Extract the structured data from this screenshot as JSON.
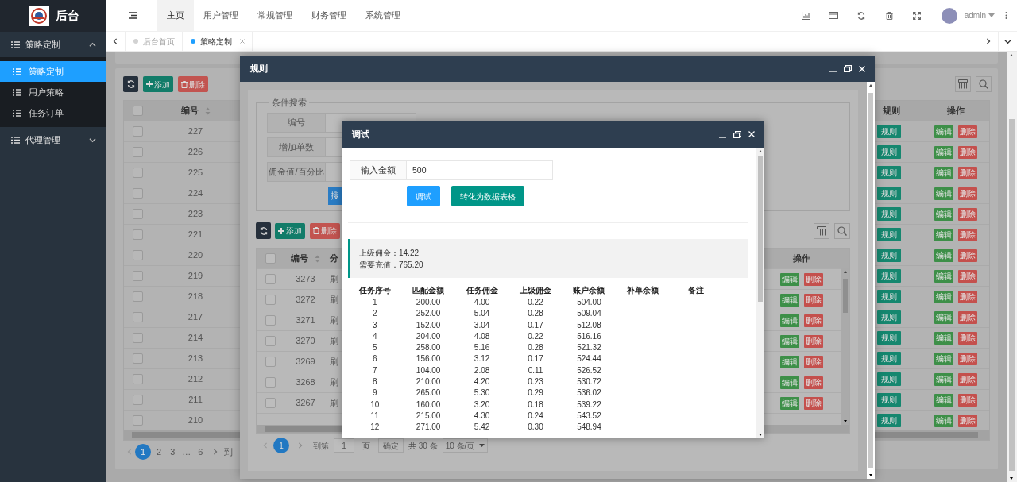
{
  "sidebar": {
    "logo_text": "后台",
    "menu": [
      {
        "label": "策略定制",
        "expanded": true,
        "children": [
          {
            "label": "策略定制",
            "selected": true
          },
          {
            "label": "用户策略",
            "selected": false
          },
          {
            "label": "任务订单",
            "selected": false
          }
        ]
      },
      {
        "label": "代理管理",
        "expanded": false
      }
    ]
  },
  "header": {
    "nav": [
      {
        "label": "主页",
        "selected": true
      },
      {
        "label": "用户管理",
        "selected": false
      },
      {
        "label": "常规管理",
        "selected": false
      },
      {
        "label": "财务管理",
        "selected": false
      },
      {
        "label": "系统管理",
        "selected": false
      }
    ],
    "user": "admin"
  },
  "tabs": [
    {
      "label": "后台首页",
      "selected": false,
      "closable": false
    },
    {
      "label": "策略定制",
      "selected": true,
      "closable": true
    }
  ],
  "page": {
    "toolbar": {
      "add": "添加",
      "delete": "删除"
    },
    "table": {
      "columns": [
        "编号",
        "规则",
        "操作"
      ],
      "all_checked": false,
      "rows": [
        {
          "id": "227",
          "checked": false,
          "rule": "规则",
          "edit": "编辑",
          "delete": "删除"
        },
        {
          "id": "226",
          "checked": false,
          "rule": "规则",
          "edit": "编辑",
          "delete": "删除"
        },
        {
          "id": "225",
          "checked": false,
          "rule": "规则",
          "edit": "编辑",
          "delete": "删除"
        },
        {
          "id": "224",
          "checked": false,
          "rule": "规则",
          "edit": "编辑",
          "delete": "删除"
        },
        {
          "id": "223",
          "checked": false,
          "rule": "规则",
          "edit": "编辑",
          "delete": "删除"
        },
        {
          "id": "221",
          "checked": false,
          "rule": "规则",
          "edit": "编辑",
          "delete": "删除"
        },
        {
          "id": "220",
          "checked": false,
          "rule": "规则",
          "edit": "编辑",
          "delete": "删除"
        },
        {
          "id": "219",
          "checked": false,
          "rule": "规则",
          "edit": "编辑",
          "delete": "删除"
        },
        {
          "id": "218",
          "checked": false,
          "rule": "规则",
          "edit": "编辑",
          "delete": "删除"
        },
        {
          "id": "217",
          "checked": false,
          "rule": "规则",
          "edit": "编辑",
          "delete": "删除"
        },
        {
          "id": "214",
          "checked": false,
          "rule": "规则",
          "edit": "编辑",
          "delete": "删除"
        },
        {
          "id": "213",
          "checked": false,
          "rule": "规则",
          "edit": "编辑",
          "delete": "删除"
        },
        {
          "id": "212",
          "checked": false,
          "rule": "规则",
          "edit": "编辑",
          "delete": "删除"
        },
        {
          "id": "211",
          "checked": false,
          "rule": "规则",
          "edit": "编辑",
          "delete": "删除"
        },
        {
          "id": "210",
          "checked": false,
          "rule": "规则",
          "edit": "编辑",
          "delete": "删除"
        }
      ]
    },
    "pagination": {
      "pages": [
        {
          "label": "1",
          "kind": "page",
          "selected": true
        },
        {
          "label": "2",
          "kind": "page",
          "selected": false
        },
        {
          "label": "3",
          "kind": "page",
          "selected": false
        },
        {
          "label": "…",
          "kind": "ellipsis"
        },
        {
          "label": "6",
          "kind": "page",
          "selected": false
        }
      ],
      "goto_label": "到"
    }
  },
  "rule_dialog": {
    "title": "规则",
    "search": {
      "legend": "条件搜索",
      "fields": [
        "编号",
        "增加单数",
        "佣金值/百分比"
      ],
      "button": "搜"
    },
    "toolbar": {
      "add": "添加",
      "delete": "删除"
    },
    "table": {
      "columns": [
        "编号",
        "分",
        "操作"
      ],
      "all_checked": false,
      "rows": [
        {
          "id": "3273",
          "checked": false,
          "column_2": "刷",
          "edit": "编辑",
          "delete": "删除"
        },
        {
          "id": "3272",
          "checked": false,
          "column_2": "刷",
          "edit": "编辑",
          "delete": "删除"
        },
        {
          "id": "3271",
          "checked": false,
          "column_2": "刷",
          "edit": "编辑",
          "delete": "删除"
        },
        {
          "id": "3270",
          "checked": false,
          "column_2": "刷",
          "edit": "编辑",
          "delete": "删除"
        },
        {
          "id": "3269",
          "checked": false,
          "column_2": "刷",
          "edit": "编辑",
          "delete": "删除"
        },
        {
          "id": "3268",
          "checked": false,
          "column_2": "刷",
          "edit": "编辑",
          "delete": "删除"
        },
        {
          "id": "3267",
          "checked": false,
          "column_2": "刷",
          "edit": "编辑",
          "delete": "删除"
        }
      ]
    },
    "pagination": {
      "pages": [
        {
          "label": "1",
          "selected": true
        }
      ],
      "goto_label": "到第",
      "goto_value": "1",
      "page_label": "页",
      "confirm": "确定",
      "total": "共 30 条",
      "page_size": "10 条/页"
    }
  },
  "debug_dialog": {
    "title": "调试",
    "amount_label": "输入金额",
    "amount_value": "500",
    "buttons": [
      {
        "label": "调试",
        "kind": "primary"
      },
      {
        "label": "转化为数据表格",
        "kind": "teal"
      }
    ],
    "summary": [
      "上级佣金：14.22",
      "需要充值：765.20"
    ],
    "table": {
      "columns": [
        "任务序号",
        "匹配金额",
        "任务佣金",
        "上级佣金",
        "账户余额",
        "补单余额",
        "备注"
      ],
      "rows": [
        [
          "1",
          "200.00",
          "4.00",
          "0.22",
          "504.00"
        ],
        [
          "2",
          "252.00",
          "5.04",
          "0.28",
          "509.04"
        ],
        [
          "3",
          "152.00",
          "3.04",
          "0.17",
          "512.08"
        ],
        [
          "4",
          "204.00",
          "4.08",
          "0.22",
          "516.16"
        ],
        [
          "5",
          "258.00",
          "5.16",
          "0.28",
          "521.32"
        ],
        [
          "6",
          "156.00",
          "3.12",
          "0.17",
          "524.44"
        ],
        [
          "7",
          "104.00",
          "2.08",
          "0.11",
          "526.52"
        ],
        [
          "8",
          "210.00",
          "4.20",
          "0.23",
          "530.72"
        ],
        [
          "9",
          "265.00",
          "5.30",
          "0.29",
          "536.02"
        ],
        [
          "10",
          "160.00",
          "3.20",
          "0.18",
          "539.22"
        ],
        [
          "11",
          "215.00",
          "4.30",
          "0.24",
          "543.52"
        ],
        [
          "12",
          "271.00",
          "5.42",
          "0.30",
          "548.94"
        ]
      ]
    }
  }
}
